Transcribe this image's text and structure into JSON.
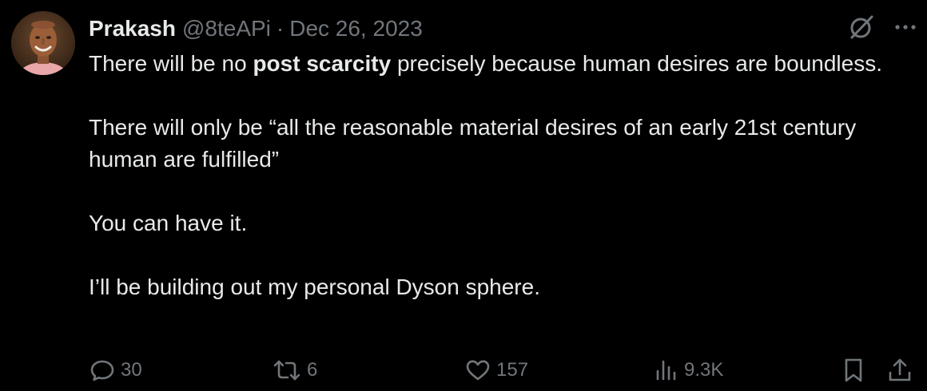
{
  "tweet": {
    "author": {
      "name": "Prakash",
      "handle": "@8teAPi",
      "avatar_icon": "user-avatar-photo"
    },
    "separator": "·",
    "date": "Dec 26, 2023",
    "top_icons": [
      "grok-icon",
      "more-options-icon"
    ],
    "text": {
      "p1_before": "There will be no ",
      "p1_bold": "post scarcity",
      "p1_after": " precisely because human desires are boundless.",
      "p2": "There will only be “all the reasonable material desires of an early 21st century human are fulfilled”",
      "p3": "You can have it.",
      "p4": "I’ll be building out my personal Dyson sphere."
    },
    "actions": {
      "replies": "30",
      "reposts": "6",
      "likes": "157",
      "views": "9.3K"
    }
  },
  "colors": {
    "background": "#000000",
    "text_primary": "#e7e9ea",
    "text_secondary": "#71767b"
  }
}
